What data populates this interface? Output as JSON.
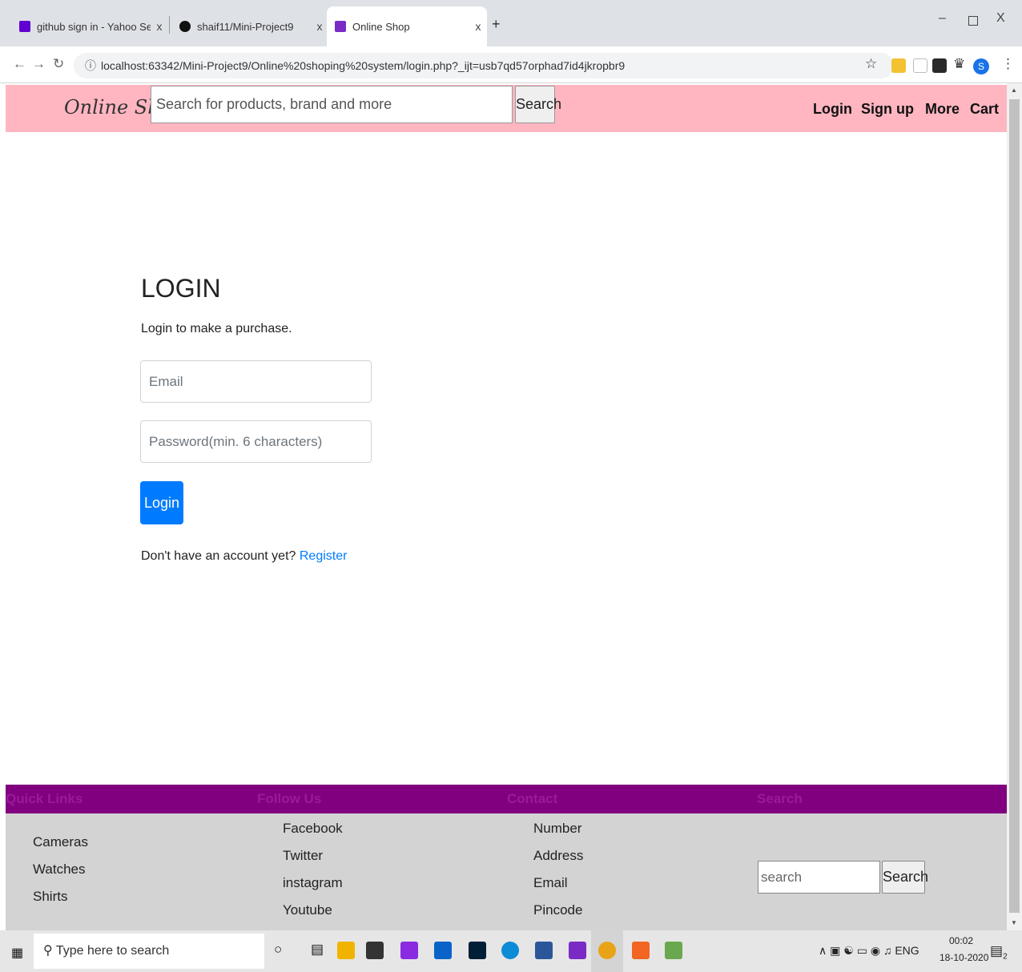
{
  "browser": {
    "tabs": [
      {
        "title": "github sign in - Yahoo Search Re",
        "active": false,
        "favicon_color": "#6001d2",
        "favicon": "yahoo-favicon-icon"
      },
      {
        "title": "shaif11/Mini-Project9",
        "active": false,
        "favicon_color": "#111111",
        "favicon": "github-favicon-icon"
      },
      {
        "title": "Online Shop",
        "active": true,
        "favicon_color": "#7a2bc6",
        "favicon": "phpstorm-favicon-icon"
      }
    ],
    "close_glyph": "x",
    "new_tab_glyph": "+",
    "url": "localhost:63342/Mini-Project9/Online%20shoping%20system/login.php?_ijt=usb7qd57orphad7id4jkropbr9",
    "profile_initial": "S"
  },
  "header": {
    "logo": "Online Shop",
    "search_placeholder": "Search for products, brand and more",
    "search_button": "Search",
    "nav": [
      "Login",
      "Sign up",
      "More",
      "Cart"
    ],
    "background": "#ffb6c1"
  },
  "login": {
    "title": "LOGIN",
    "subtitle": "Login to make a purchase.",
    "email_placeholder": "Email",
    "password_placeholder": "Password(min. 6 characters)",
    "button": "Login",
    "register_prompt": "Don't have an account yet?",
    "register_link": "Register",
    "accent": "#007bff"
  },
  "footer": {
    "quick_links_title": "Quick Links",
    "quick_links": [
      "Cameras",
      "Watches",
      "Shirts"
    ],
    "follow_title": "Follow Us",
    "follow": [
      "Facebook",
      "Twitter",
      "instagram",
      "Youtube"
    ],
    "contact_title": "Contact",
    "contact": [
      "Number",
      "Address",
      "Email",
      "Pincode"
    ],
    "search_title": "Search",
    "search_placeholder": "search",
    "search_button": "Search",
    "head_background": "#800080",
    "body_background": "#d3d3d3"
  },
  "taskbar": {
    "search_placeholder": "Type here to search",
    "language": "ENG",
    "time": "00:02",
    "date": "18-10-2020",
    "notification_count": "2"
  }
}
